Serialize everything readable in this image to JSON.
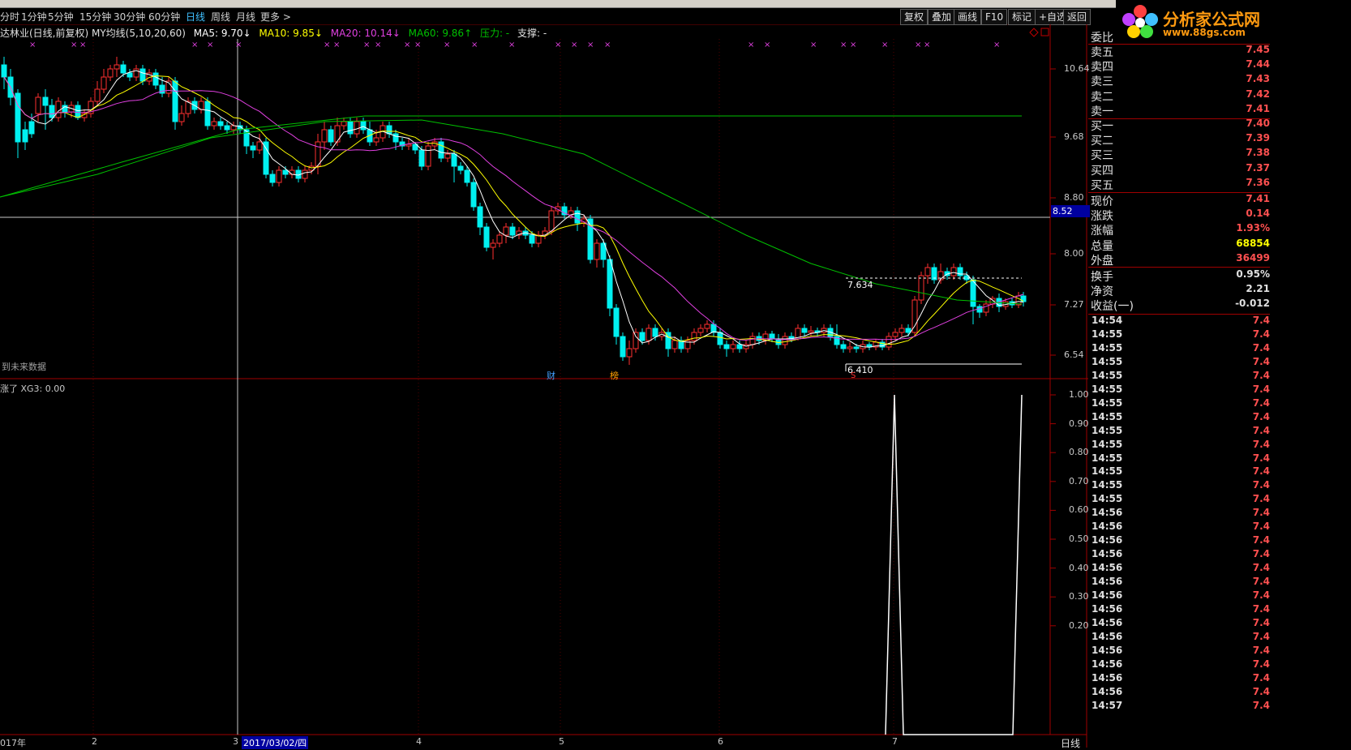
{
  "toolbar": {
    "periods": [
      "分时",
      "1分钟",
      "5分钟",
      "15分钟",
      "30分钟",
      "60分钟",
      "日线",
      "周线",
      "月线",
      "更多 >"
    ],
    "active_period": "日线",
    "right_buttons": [
      "复权",
      "叠加",
      "画线",
      "F10",
      "标记",
      "+自选",
      "返回"
    ]
  },
  "logo": {
    "text": "分析家公式网",
    "url": "www.88gs.com"
  },
  "main_chart": {
    "title": "达林业(日线,前复权) MY均线(5,10,20,60)",
    "ma5": "MA5: 9.70↓",
    "ma10": "MA10: 9.85↓",
    "ma20": "MA20: 10.14↓",
    "ma60": "MA60: 9.86↑",
    "pressure": "压力: -",
    "support": "支撑: -",
    "price_ticks": [
      "10.64",
      "9.68",
      "8.80",
      "8.00",
      "7.27",
      "6.54"
    ],
    "cursor_price": "8.52",
    "high_note": "7.634",
    "low_note": "6.410",
    "future_note": "到未来数据",
    "markers": [
      "财",
      "榜",
      "S"
    ],
    "colors": {
      "up": "#ff3030",
      "down": "#00f0f0",
      "ma5": "#ffffff",
      "ma10": "#ffff00",
      "ma20": "#e040e0",
      "ma60": "#00c000"
    }
  },
  "sub_chart": {
    "title": "涨了 XG3: 0.00",
    "ticks": [
      "1.00",
      "0.90",
      "0.80",
      "0.70",
      "0.60",
      "0.50",
      "0.40",
      "0.30",
      "0.20"
    ]
  },
  "date_axis": {
    "labels": [
      "017年",
      "2",
      "3",
      "2017/03/02/四",
      "4",
      "5",
      "6",
      "7"
    ],
    "period_label": "日线"
  },
  "order_book": {
    "header": "委比",
    "asks": [
      {
        "label": "卖五",
        "price": "7.45"
      },
      {
        "label": "卖四",
        "price": "7.44"
      },
      {
        "label": "卖三",
        "price": "7.43"
      },
      {
        "label": "卖二",
        "price": "7.42"
      },
      {
        "label": "卖一",
        "price": "7.41"
      }
    ],
    "bids": [
      {
        "label": "买一",
        "price": "7.40"
      },
      {
        "label": "买二",
        "price": "7.39"
      },
      {
        "label": "买三",
        "price": "7.38"
      },
      {
        "label": "买四",
        "price": "7.37"
      },
      {
        "label": "买五",
        "price": "7.36"
      }
    ]
  },
  "quote": [
    {
      "label": "现价",
      "value": "7.41",
      "color": "#ff5050"
    },
    {
      "label": "涨跌",
      "value": "0.14",
      "color": "#ff5050"
    },
    {
      "label": "涨幅",
      "value": "1.93%",
      "color": "#ff5050"
    },
    {
      "label": "总量",
      "value": "68854",
      "color": "#ffff00"
    },
    {
      "label": "外盘",
      "value": "36499",
      "color": "#ff5050"
    },
    {
      "label": "换手",
      "value": "0.95%",
      "color": "#e0e0e0"
    },
    {
      "label": "净资",
      "value": "2.21",
      "color": "#e0e0e0"
    },
    {
      "label": "收益(一)",
      "value": "-0.012",
      "color": "#e0e0e0"
    }
  ],
  "ticks": [
    {
      "time": "14:54",
      "price": "7.4"
    },
    {
      "time": "14:55",
      "price": "7.4"
    },
    {
      "time": "14:55",
      "price": "7.4"
    },
    {
      "time": "14:55",
      "price": "7.4"
    },
    {
      "time": "14:55",
      "price": "7.4"
    },
    {
      "time": "14:55",
      "price": "7.4"
    },
    {
      "time": "14:55",
      "price": "7.4"
    },
    {
      "time": "14:55",
      "price": "7.4"
    },
    {
      "time": "14:55",
      "price": "7.4"
    },
    {
      "time": "14:55",
      "price": "7.4"
    },
    {
      "time": "14:55",
      "price": "7.4"
    },
    {
      "time": "14:55",
      "price": "7.4"
    },
    {
      "time": "14:55",
      "price": "7.4"
    },
    {
      "time": "14:55",
      "price": "7.4"
    },
    {
      "time": "14:56",
      "price": "7.4"
    },
    {
      "time": "14:56",
      "price": "7.4"
    },
    {
      "time": "14:56",
      "price": "7.4"
    },
    {
      "time": "14:56",
      "price": "7.4"
    },
    {
      "time": "14:56",
      "price": "7.4"
    },
    {
      "time": "14:56",
      "price": "7.4"
    },
    {
      "time": "14:56",
      "price": "7.4"
    },
    {
      "time": "14:56",
      "price": "7.4"
    },
    {
      "time": "14:56",
      "price": "7.4"
    },
    {
      "time": "14:56",
      "price": "7.4"
    },
    {
      "time": "14:56",
      "price": "7.4"
    },
    {
      "time": "14:56",
      "price": "7.4"
    },
    {
      "time": "14:56",
      "price": "7.4"
    },
    {
      "time": "14:56",
      "price": "7.4"
    },
    {
      "time": "14:57",
      "price": "7.4"
    }
  ]
}
